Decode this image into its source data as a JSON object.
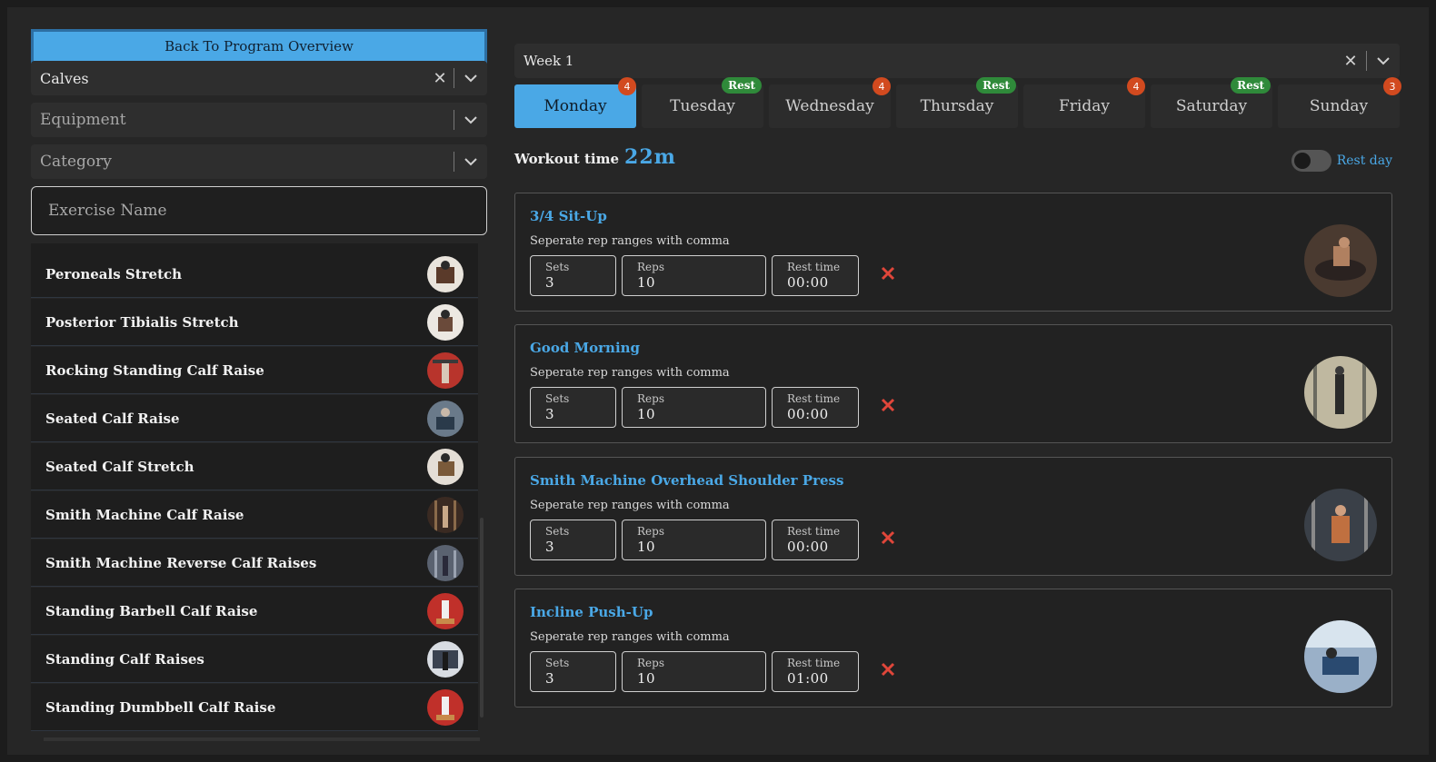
{
  "sidebar": {
    "back_button": "Back To Program Overview",
    "muscle_select": {
      "value": "Calves"
    },
    "equipment_select": {
      "placeholder": "Equipment"
    },
    "category_select": {
      "placeholder": "Category"
    },
    "search": {
      "placeholder": "Exercise Name"
    },
    "exercises": [
      {
        "label": "Peroneals Stretch"
      },
      {
        "label": "Posterior Tibialis Stretch"
      },
      {
        "label": "Rocking Standing Calf Raise"
      },
      {
        "label": "Seated Calf Raise"
      },
      {
        "label": "Seated Calf Stretch"
      },
      {
        "label": "Smith Machine Calf Raise"
      },
      {
        "label": "Smith Machine Reverse Calf Raises"
      },
      {
        "label": "Standing Barbell Calf Raise"
      },
      {
        "label": "Standing Calf Raises"
      },
      {
        "label": "Standing Dumbbell Calf Raise"
      }
    ]
  },
  "main": {
    "week_select": {
      "value": "Week 1"
    },
    "days": [
      {
        "label": "Monday",
        "badge": "4",
        "badge_type": "count",
        "active": true
      },
      {
        "label": "Tuesday",
        "badge": "Rest",
        "badge_type": "rest",
        "active": false
      },
      {
        "label": "Wednesday",
        "badge": "4",
        "badge_type": "count",
        "active": false
      },
      {
        "label": "Thursday",
        "badge": "Rest",
        "badge_type": "rest",
        "active": false
      },
      {
        "label": "Friday",
        "badge": "4",
        "badge_type": "count",
        "active": false
      },
      {
        "label": "Saturday",
        "badge": "Rest",
        "badge_type": "rest",
        "active": false
      },
      {
        "label": "Sunday",
        "badge": "3",
        "badge_type": "count",
        "active": false
      }
    ],
    "workout_time": {
      "label": "Workout time",
      "value": "22m"
    },
    "rest_day": {
      "label": "Rest day",
      "on": false
    },
    "fields": {
      "sets_label": "Sets",
      "reps_label": "Reps",
      "rest_label": "Rest time"
    },
    "hint": "Seperate rep ranges with comma",
    "exercises": [
      {
        "title": "3/4 Sit-Up",
        "sets": "3",
        "reps": "10",
        "rest": "00:00"
      },
      {
        "title": "Good Morning",
        "sets": "3",
        "reps": "10",
        "rest": "00:00"
      },
      {
        "title": "Smith Machine Overhead Shoulder Press",
        "sets": "3",
        "reps": "10",
        "rest": "00:00"
      },
      {
        "title": "Incline Push-Up",
        "sets": "3",
        "reps": "10",
        "rest": "01:00"
      }
    ]
  },
  "colors": {
    "accent": "#4aa8e6",
    "badge_count": "#d24a1f",
    "badge_rest": "#2f8a3a",
    "delete": "#e0463a"
  },
  "icons": {
    "clear": "close-icon",
    "dropdown": "chevron-down-icon",
    "delete": "delete-x-icon"
  }
}
